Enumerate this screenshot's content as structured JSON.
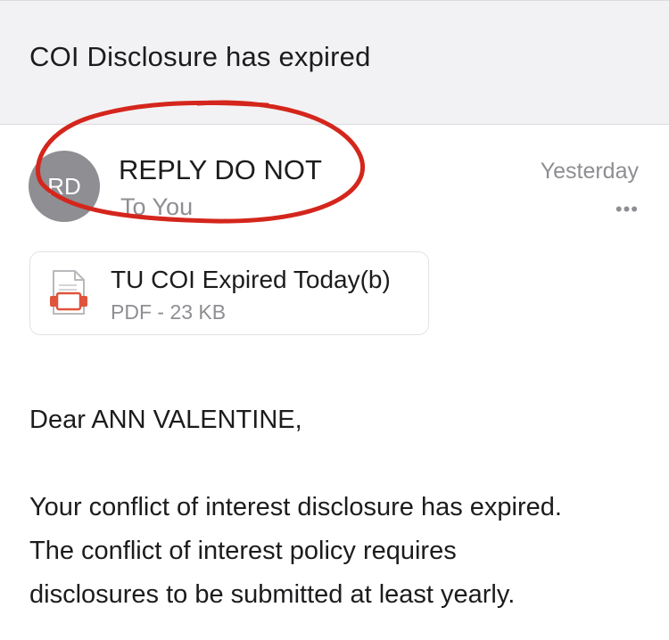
{
  "subject": "COI Disclosure has expired",
  "message": {
    "avatar_initials": "RD",
    "sender": "REPLY DO NOT",
    "recipient": "To You",
    "date": "Yesterday",
    "more_icon": "more-ellipsis-icon"
  },
  "attachment": {
    "name": "TU COI Expired Today(b)",
    "meta": "PDF - 23 KB",
    "icon": "pdf-file-icon"
  },
  "body": {
    "greeting": "Dear ANN VALENTINE,",
    "line1": "Your conflict of interest disclosure has expired.",
    "line2": "The conflict of interest policy requires",
    "line3": "disclosures to be submitted at least yearly."
  },
  "colors": {
    "annotation_red": "#d4261c",
    "header_background": "#f2f2f4",
    "secondary_text": "#8e8e93",
    "pdf_accent": "#e0533c"
  }
}
